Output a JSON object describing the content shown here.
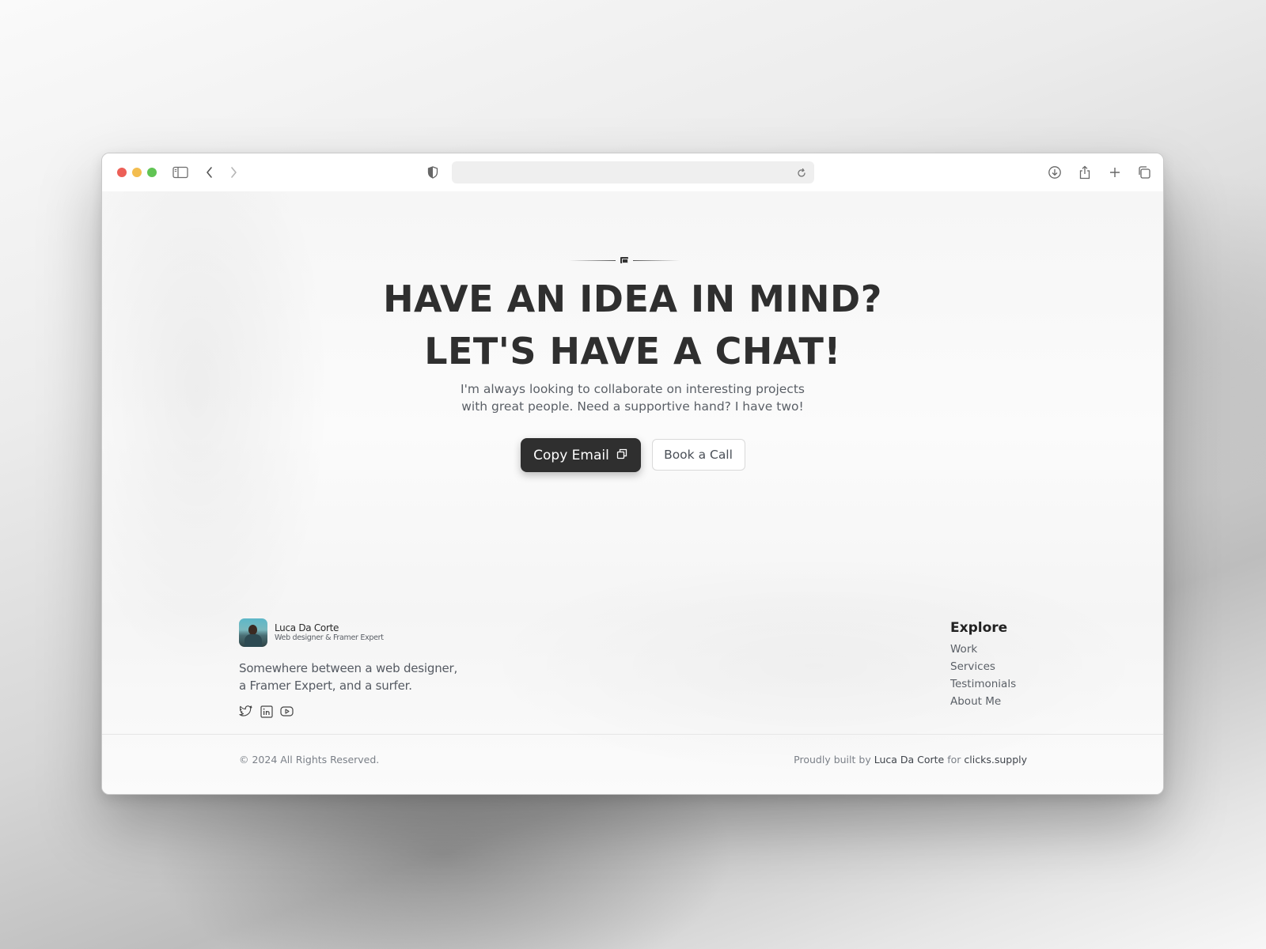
{
  "browser": {
    "address_value": "",
    "icons": {
      "sidebar": "sidebar-icon",
      "back": "chevron-left-icon",
      "forward": "chevron-right-icon",
      "privacy": "shield-icon",
      "reload": "reload-icon",
      "download": "download-icon",
      "share": "share-icon",
      "new_tab": "plus-icon",
      "tabs": "tabs-overview-icon"
    }
  },
  "hero": {
    "ornament_icon": "envelope-icon",
    "headline_line1": "HAVE AN IDEA IN MIND?",
    "headline_line2": "LET'S HAVE A CHAT!",
    "subtext_line1": "I'm always looking to collaborate on interesting projects",
    "subtext_line2": "with great people. Need a supportive hand? I have two!",
    "primary_button": "Copy Email",
    "primary_button_icon": "copy-icon",
    "secondary_button": "Book a Call"
  },
  "footer": {
    "profile": {
      "name": "Luca Da Corte",
      "role": "Web designer & Framer Expert"
    },
    "tagline_line1": "Somewhere between a web designer,",
    "tagline_line2": "a Framer Expert, and a surfer.",
    "socials": [
      "twitter-icon",
      "linkedin-icon",
      "youtube-icon"
    ],
    "explore": {
      "title": "Explore",
      "links": [
        "Work",
        "Services",
        "Testimonials",
        "About Me"
      ]
    },
    "copyright": "© 2024 All Rights Reserved.",
    "built_prefix": "Proudly built by",
    "built_author": "Luca Da Corte",
    "built_mid": "for",
    "built_site": "clicks.supply"
  },
  "colors": {
    "primary_button_bg": "#2f2f2f",
    "headline": "#2f2f2f",
    "traffic_red": "#ec5f57",
    "traffic_yellow": "#f3bd4f",
    "traffic_green": "#61c454"
  }
}
